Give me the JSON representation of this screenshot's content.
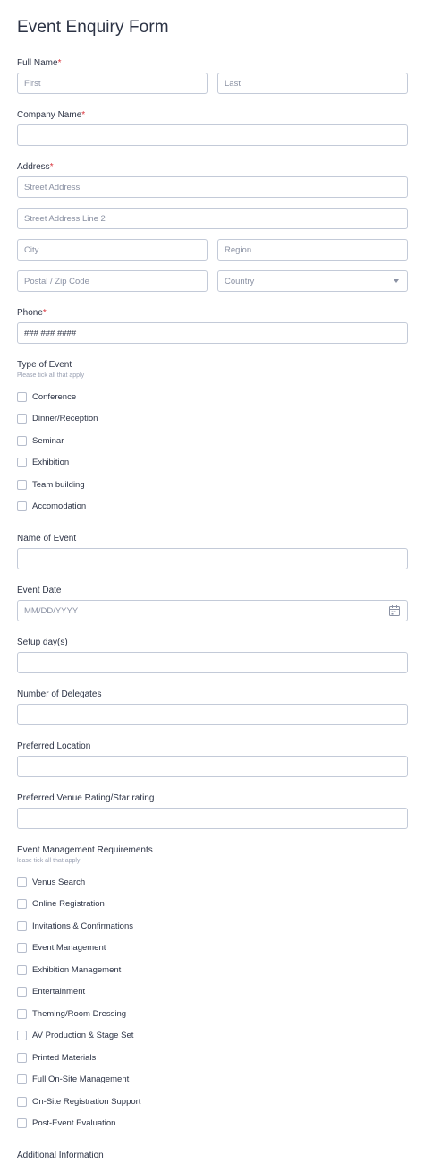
{
  "form": {
    "title": "Event Enquiry Form"
  },
  "full_name": {
    "label": "Full Name",
    "required_mark": "*",
    "first_placeholder": "First",
    "last_placeholder": "Last"
  },
  "company_name": {
    "label": "Company Name",
    "required_mark": "*"
  },
  "address": {
    "label": "Address",
    "required_mark": "*",
    "street1_placeholder": "Street Address",
    "street2_placeholder": "Street Address Line 2",
    "city_placeholder": "City",
    "region_placeholder": "Region",
    "postal_placeholder": "Postal / Zip Code",
    "country_placeholder": "Country"
  },
  "phone": {
    "label": "Phone",
    "required_mark": "*",
    "placeholder": "### ### ####"
  },
  "type_of_event": {
    "label": "Type of Event",
    "sublabel": "Please tick all that apply",
    "options": [
      "Conference",
      "Dinner/Reception",
      "Seminar",
      "Exhibition",
      "Team building",
      "Accomodation"
    ]
  },
  "name_of_event": {
    "label": "Name of Event"
  },
  "event_date": {
    "label": "Event Date",
    "placeholder": "MM/DD/YYYY"
  },
  "setup_days": {
    "label": "Setup day(s)"
  },
  "number_of_delegates": {
    "label": "Number of Delegates"
  },
  "preferred_location": {
    "label": "Preferred Location"
  },
  "preferred_venue_rating": {
    "label": "Preferred Venue Rating/Star rating"
  },
  "event_management_requirements": {
    "label": "Event Management Requirements",
    "sublabel": "lease tick all that apply",
    "options": [
      "Venus Search",
      "Online Registration",
      "Invitations & Confirmations",
      "Event Management",
      "Exhibition Management",
      "Entertainment",
      "Theming/Room Dressing",
      "AV Production & Stage Set",
      "Printed Materials",
      "Full On-Site Management",
      "On-Site Registration Support",
      "Post-Event Evaluation"
    ]
  },
  "additional_information": {
    "label": "Additional Information"
  },
  "colors": {
    "border": "#c3cad8",
    "text": "#2c3345",
    "required": "#d9363e",
    "placeholder": "#8a91a3"
  },
  "icons": {
    "calendar": "calendar-icon",
    "dropdown": "chevron-down-icon"
  }
}
